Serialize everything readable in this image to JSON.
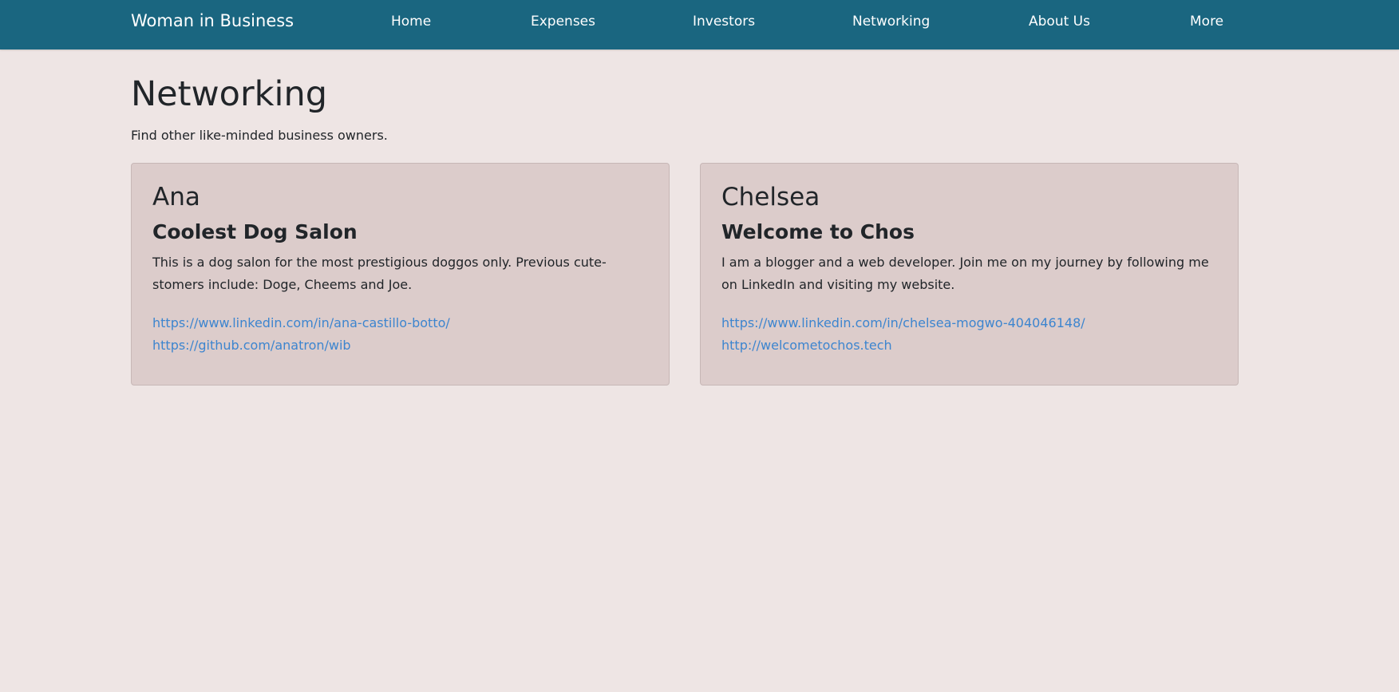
{
  "navbar": {
    "brand": "Woman in Business",
    "links": [
      {
        "label": "Home"
      },
      {
        "label": "Expenses"
      },
      {
        "label": "Investors"
      },
      {
        "label": "Networking"
      },
      {
        "label": "About Us"
      },
      {
        "label": "More"
      }
    ],
    "background_color": "#1a6680"
  },
  "page": {
    "title": "Networking",
    "subtitle": "Find other like-minded business owners."
  },
  "profiles": [
    {
      "name": "Ana",
      "business": "Coolest Dog Salon",
      "description": "This is a dog salon for the most prestigious doggos only. Previous cute-stomers include: Doge, Cheems and Joe.",
      "links": [
        "https://www.linkedin.com/in/ana-castillo-botto/",
        "https://github.com/anatron/wib"
      ]
    },
    {
      "name": "Chelsea",
      "business": "Welcome to Chos",
      "description": "I am a blogger and a web developer. Join me on my journey by following me on LinkedIn and visiting my website.",
      "links": [
        "https://www.linkedin.com/in/chelsea-mogwo-404046148/",
        "http://welcometochos.tech"
      ]
    }
  ],
  "colors": {
    "page_background": "#eee5e4",
    "card_background": "#dccccb",
    "link": "#3d85cf"
  }
}
